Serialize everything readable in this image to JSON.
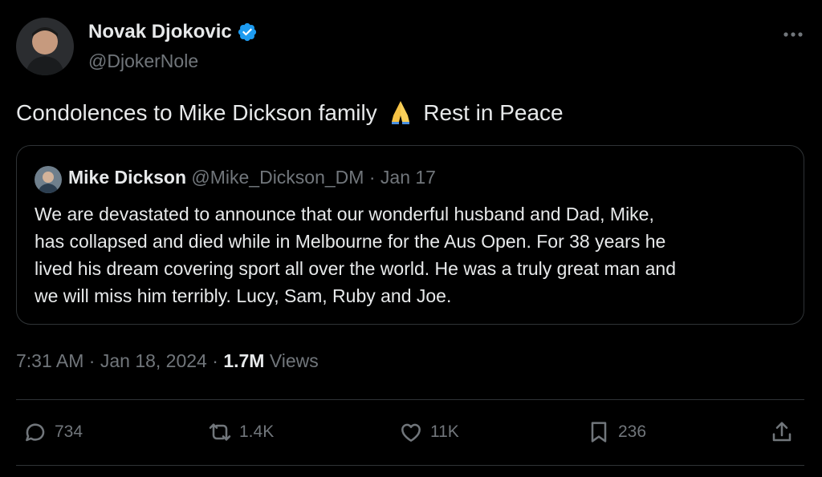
{
  "author": {
    "name": "Novak Djokovic",
    "handle": "@DjokerNole",
    "verified": true
  },
  "tweet": {
    "text_before": "Condolences to Mike Dickson family",
    "emoji": "folded-hands",
    "text_after": "Rest in Peace"
  },
  "quoted": {
    "name": "Mike Dickson",
    "handle": "@Mike_Dickson_DM",
    "separator": "·",
    "date": "Jan 17",
    "lines": [
      "We are devastated to announce that our wonderful husband and Dad, Mike,",
      "has collapsed and died while in Melbourne for the Aus Open. For 38 years he",
      "lived his dream covering sport all over the world. He was a truly great man and",
      "we will miss him terribly. Lucy, Sam, Ruby and Joe."
    ]
  },
  "meta": {
    "time": "7:31 AM",
    "separator": "·",
    "date": "Jan 18, 2024",
    "views_count": "1.7M",
    "views_label": "Views"
  },
  "actions": {
    "replies": "734",
    "reposts": "1.4K",
    "likes": "11K",
    "bookmarks": "236"
  },
  "colors": {
    "background": "#000000",
    "text": "#e7e9ea",
    "secondary": "#71767b",
    "border": "#2f3336",
    "verified": "#1d9bf0"
  }
}
